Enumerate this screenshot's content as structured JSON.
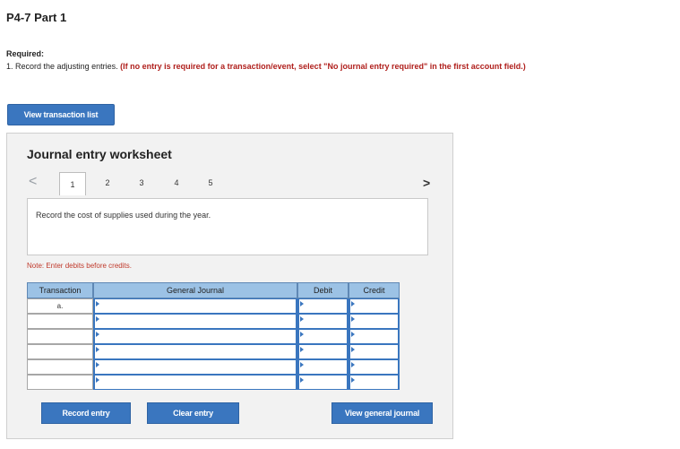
{
  "page": {
    "title": "P4-7 Part 1",
    "required_label": "Required:",
    "instruction_number": "1.",
    "instruction_text": "Record the adjusting entries.",
    "instruction_warning": "(If no entry is required for a transaction/event, select \"No journal entry required\" in the first account field.)"
  },
  "buttons": {
    "view_transaction_list": "View transaction list",
    "record_entry": "Record entry",
    "clear_entry": "Clear entry",
    "view_general_journal": "View general journal"
  },
  "worksheet": {
    "title": "Journal entry worksheet",
    "tabs": [
      "1",
      "2",
      "3",
      "4",
      "5"
    ],
    "active_tab": "1",
    "prev_arrow": "<",
    "next_arrow": ">",
    "description": "Record the cost of supplies used during the year.",
    "note": "Note: Enter debits before credits."
  },
  "journal_table": {
    "headers": {
      "transaction": "Transaction",
      "general_journal": "General Journal",
      "debit": "Debit",
      "credit": "Credit"
    },
    "rows": [
      {
        "transaction": "a.",
        "account": "",
        "debit": "",
        "credit": ""
      },
      {
        "transaction": "",
        "account": "",
        "debit": "",
        "credit": ""
      },
      {
        "transaction": "",
        "account": "",
        "debit": "",
        "credit": ""
      },
      {
        "transaction": "",
        "account": "",
        "debit": "",
        "credit": ""
      },
      {
        "transaction": "",
        "account": "",
        "debit": "",
        "credit": ""
      },
      {
        "transaction": "",
        "account": "",
        "debit": "",
        "credit": ""
      }
    ]
  },
  "colors": {
    "button_blue": "#3a76bf",
    "header_blue": "#9cc2e5",
    "warning_red": "#b0201d"
  }
}
